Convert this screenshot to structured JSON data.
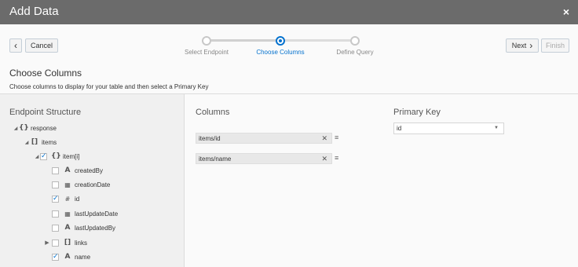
{
  "window": {
    "title": "Add Data",
    "close_icon": "×"
  },
  "wizard": {
    "cancel_label": "Cancel",
    "back_icon": "‹",
    "next_label": "Next",
    "next_icon": "›",
    "finish_label": "Finish",
    "steps": [
      "Select Endpoint",
      "Choose Columns",
      "Define Query"
    ],
    "current_step": 1
  },
  "section": {
    "title": "Choose Columns",
    "description": "Choose columns to display for your table and then select a Primary Key"
  },
  "endpoint": {
    "title": "Endpoint Structure",
    "tree": [
      {
        "label": "response",
        "icon": "{}"
      },
      {
        "label": "items",
        "icon": "[]"
      },
      {
        "label": "item[i]",
        "icon": "{}"
      },
      {
        "label": "createdBy",
        "icon": "A"
      },
      {
        "label": "creationDate",
        "icon": "▦"
      },
      {
        "label": "id",
        "icon": "#"
      },
      {
        "label": "lastUpdateDate",
        "icon": "▦"
      },
      {
        "label": "lastUpdatedBy",
        "icon": "A"
      },
      {
        "label": "links",
        "icon": "[]"
      },
      {
        "label": "name",
        "icon": "A"
      }
    ]
  },
  "columns": {
    "title": "Columns",
    "items": [
      "items/id",
      "items/name"
    ],
    "remove_icon": "✕",
    "drag_icon": "≡"
  },
  "primary_key": {
    "title": "Primary Key",
    "value": "id",
    "caret": "▼"
  },
  "colors": {
    "titlebar": "#6b6b6b",
    "accent": "#0572ce"
  }
}
